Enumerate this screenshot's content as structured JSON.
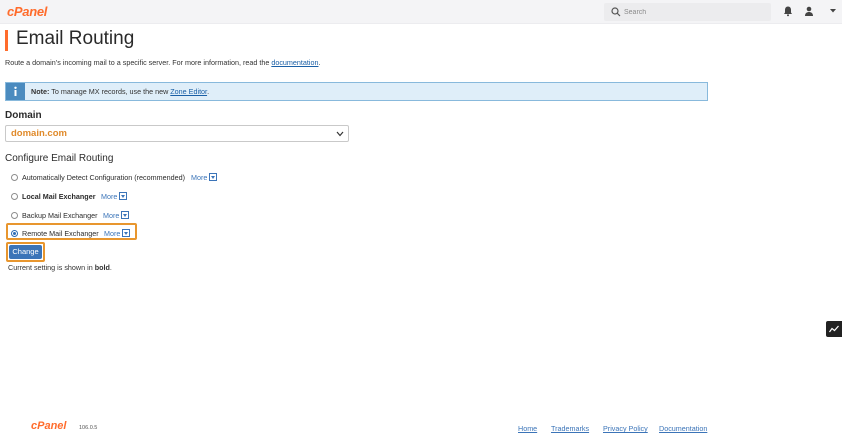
{
  "brand": {
    "logo_text": "cPanel",
    "accent": "#ff6c2c",
    "link": "#3b74b8"
  },
  "topbar": {
    "search_placeholder": "Search",
    "icons": [
      "search-icon",
      "bell-icon",
      "user-icon",
      "caret-down-icon"
    ]
  },
  "page": {
    "title": "Email Routing",
    "intro_text": "Route a domain’s incoming mail to a specific server. For more information, read the ",
    "intro_link": "documentation",
    "intro_end": "."
  },
  "note": {
    "label": "Note:",
    "text": " To manage MX records, use the new ",
    "link": "Zone Editor",
    "end": "."
  },
  "domain": {
    "label": "Domain",
    "selected": "domain.com"
  },
  "routing": {
    "label": "Configure Email Routing",
    "more_label": "More",
    "options": [
      {
        "label": "Automatically Detect Configuration (recommended)",
        "checked": false,
        "bold": false
      },
      {
        "label": "Local Mail Exchanger",
        "checked": false,
        "bold": true
      },
      {
        "label": "Backup Mail Exchanger",
        "checked": false,
        "bold": false
      },
      {
        "label": "Remote Mail Exchanger",
        "checked": true,
        "bold": false
      }
    ]
  },
  "actions": {
    "change_label": "Change"
  },
  "current_note": {
    "text": "Current setting is shown in ",
    "bold": "bold",
    "end": "."
  },
  "footer": {
    "logo_text": "cPanel",
    "version": "106.0.5",
    "links": [
      "Home",
      "Trademarks",
      "Privacy Policy",
      "Documentation"
    ]
  }
}
